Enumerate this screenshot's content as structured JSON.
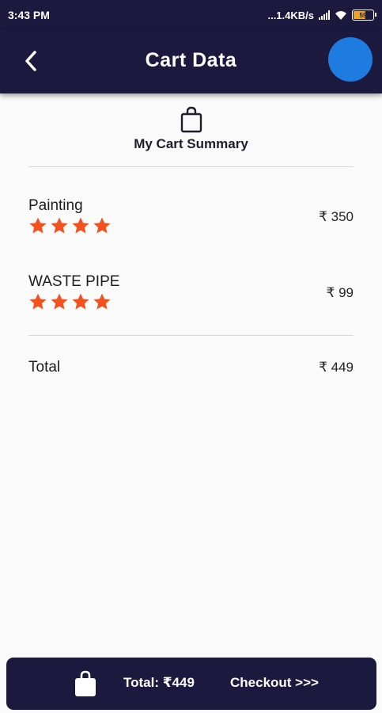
{
  "statusbar": {
    "time": "3:43 PM",
    "network_speed": "...1.4KB/s",
    "battery_level": "59",
    "icons": [
      "signal-icon",
      "wifi-icon",
      "battery-icon"
    ]
  },
  "appbar": {
    "title": "Cart Data",
    "back_icon": "chevron-left-icon",
    "avatar_color": "#1e7be0"
  },
  "summary": {
    "title": "My Cart Summary",
    "icon": "shopping-bag-icon"
  },
  "items": [
    {
      "name": "Painting",
      "price": "₹ 350",
      "rating": 4
    },
    {
      "name": "WASTE PIPE",
      "price": "₹ 99",
      "rating": 4
    }
  ],
  "total": {
    "label": "Total",
    "value": "₹ 449"
  },
  "bottom_bar": {
    "total_text": "Total: ₹449",
    "checkout_label": "Checkout >>>",
    "icon": "shopping-bag-icon"
  },
  "colors": {
    "primary_dark": "#1b1a3e",
    "star": "#f4511e",
    "avatar": "#1e7be0"
  }
}
